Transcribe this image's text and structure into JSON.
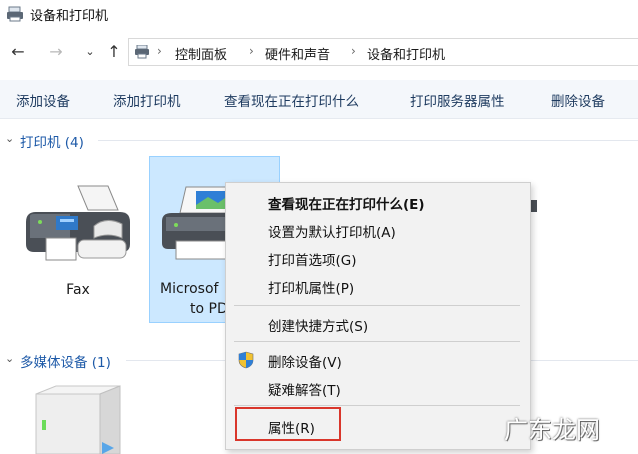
{
  "window": {
    "title": "设备和打印机"
  },
  "navigation": {
    "back_icon": "arrow-left-icon",
    "forward_icon": "arrow-right-icon",
    "recent_icon": "chevron-down-icon",
    "up_icon": "arrow-up-icon",
    "breadcrumbs": [
      "控制面板",
      "硬件和声音",
      "设备和打印机"
    ]
  },
  "commandbar": {
    "items": [
      "添加设备",
      "添加打印机",
      "查看现在正在打印什么",
      "打印服务器属性",
      "删除设备"
    ]
  },
  "groups": {
    "printers": {
      "label": "打印机 (4)"
    },
    "multimedia": {
      "label": "多媒体设备 (1)"
    }
  },
  "devices": {
    "fax": {
      "label": "Fax"
    },
    "pdf": {
      "label_line1": "Microsof",
      "label_line2": "to PD"
    }
  },
  "context_menu": {
    "items": [
      "查看现在正在打印什么(E)",
      "设置为默认打印机(A)",
      "打印首选项(G)",
      "打印机属性(P)",
      "创建快捷方式(S)",
      "删除设备(V)",
      "疑难解答(T)",
      "属性(R)"
    ]
  },
  "watermark": {
    "text": "广东龙网"
  },
  "colors": {
    "accent": "#1e5aa8",
    "selection": "#cce8ff",
    "highlight_border": "#d9362b",
    "menu_bg": "#f2f2f2"
  }
}
